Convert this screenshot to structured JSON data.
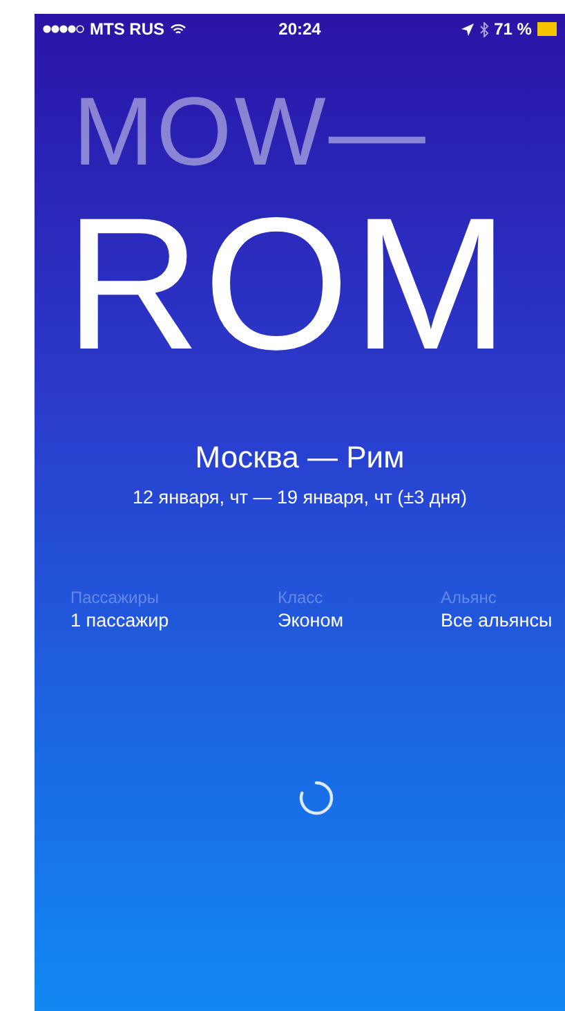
{
  "status_bar": {
    "carrier": "MTS RUS",
    "time": "20:24",
    "battery": "71 %"
  },
  "route_codes": {
    "origin": "MOW—",
    "destination": "ROM"
  },
  "route": {
    "title": "Москва — Рим",
    "dates": "12 января, чт — 19 января, чт (±3 дня)"
  },
  "options": [
    {
      "label": "Пассажиры",
      "value": "1 пассажир"
    },
    {
      "label": "Класс",
      "value": "Эконом"
    },
    {
      "label": "Альянс",
      "value": "Все альянсы"
    }
  ]
}
